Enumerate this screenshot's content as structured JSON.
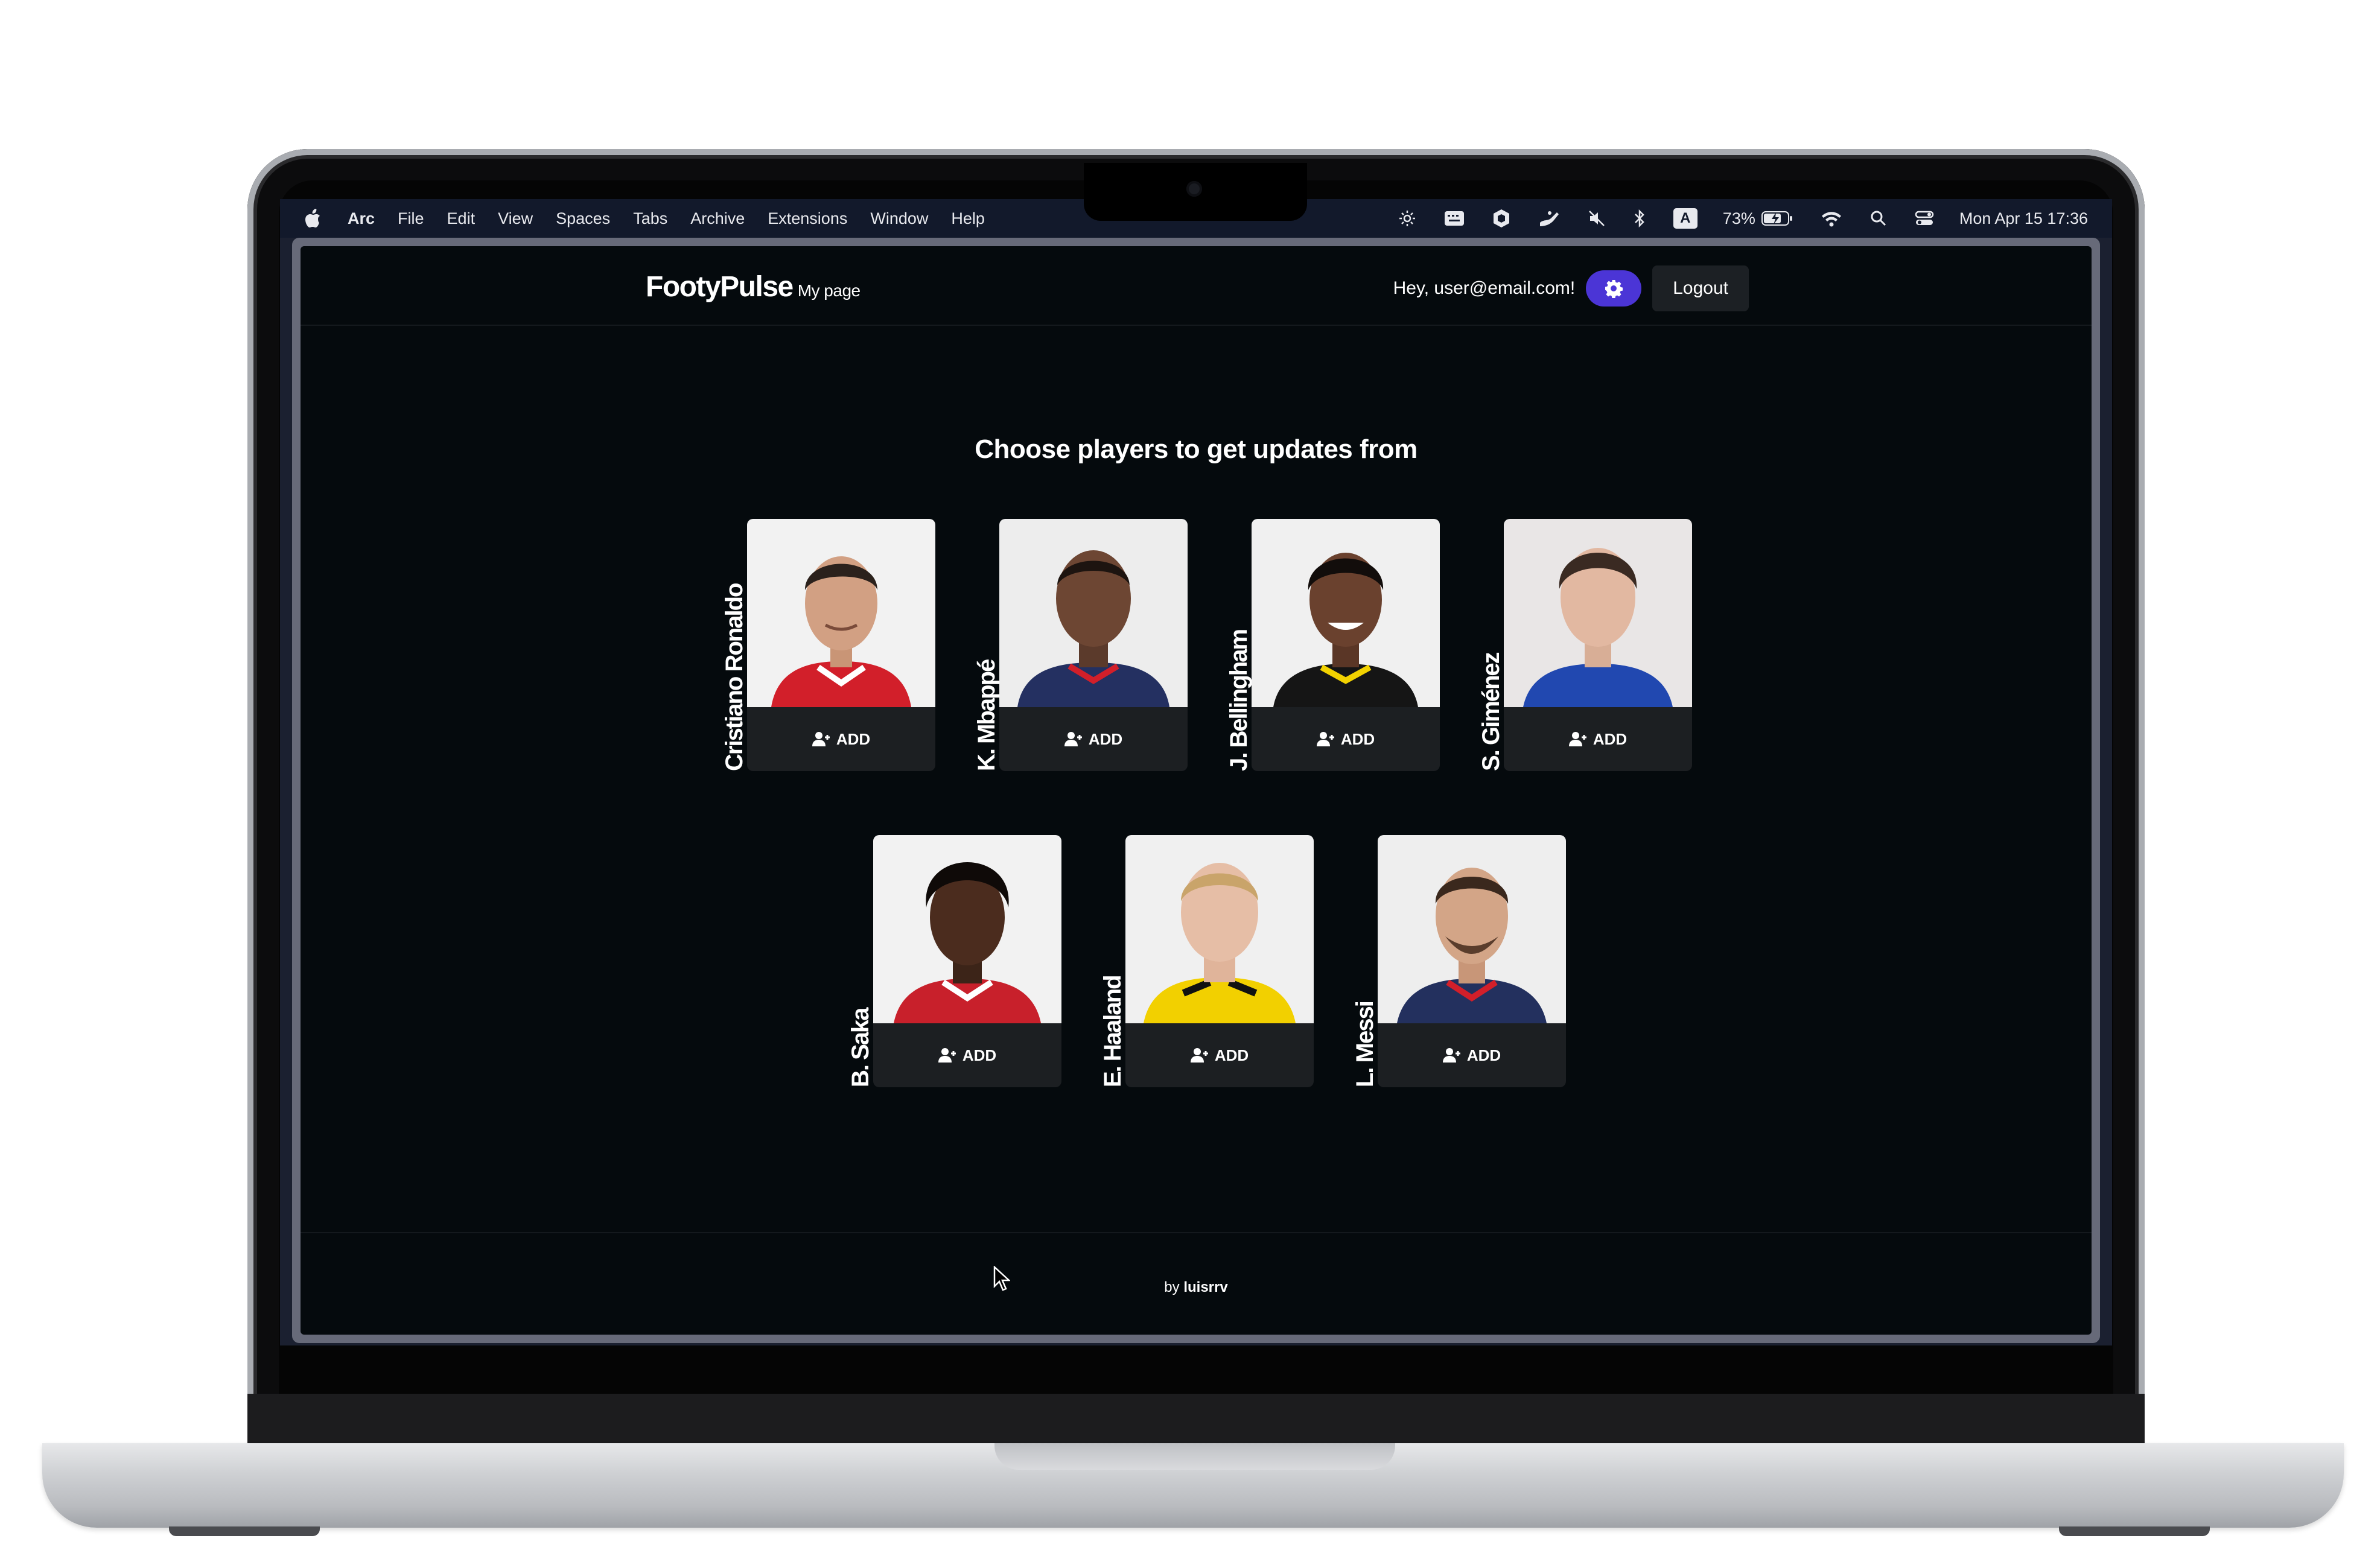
{
  "menubar": {
    "app": "Arc",
    "items": [
      "File",
      "Edit",
      "View",
      "Spaces",
      "Tabs",
      "Archive",
      "Extensions",
      "Window",
      "Help"
    ],
    "battery": "73%",
    "input_source": "A",
    "clock": "Mon Apr 15  17:36",
    "icons": [
      "brightness-icon",
      "keyboard-icon",
      "cube-icon",
      "hand-icon",
      "mute-icon",
      "bluetooth-icon",
      "input-source-icon",
      "battery-icon",
      "wifi-icon",
      "spotlight-icon",
      "control-center-icon"
    ]
  },
  "header": {
    "brand": "FootyPulse",
    "brand_sub": "My page",
    "greeting": "Hey, user@email.com!",
    "settings_icon": "gear-icon",
    "logout": "Logout"
  },
  "main": {
    "heading": "Choose players to get updates from",
    "add_label": "ADD",
    "players": [
      {
        "name": "Cristiano Ronaldo",
        "kit": "red"
      },
      {
        "name": "K. Mbappé",
        "kit": "navy"
      },
      {
        "name": "J. Bellingham",
        "kit": "black-yellow"
      },
      {
        "name": "S. Giménez",
        "kit": "blue"
      },
      {
        "name": "B. Saka",
        "kit": "red"
      },
      {
        "name": "E. Haaland",
        "kit": "yellow"
      },
      {
        "name": "L. Messi",
        "kit": "navy"
      }
    ]
  },
  "footer": {
    "by": "by",
    "author": "luisrrv"
  },
  "colors": {
    "page_bg": "#050a0d",
    "accent": "#4b35d6",
    "card_bg": "#1c1f22"
  }
}
